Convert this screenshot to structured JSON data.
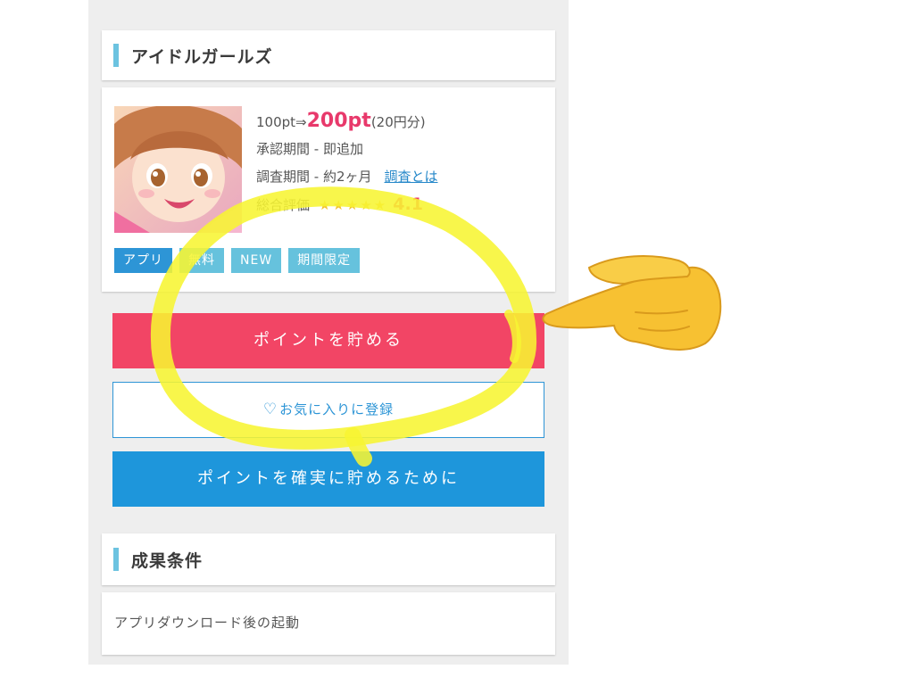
{
  "sections": {
    "offer_title": "アイドルガールズ",
    "result_title": "成果条件"
  },
  "offer": {
    "points_before": "100pt",
    "points_arrow": "⇒",
    "points_after": "200pt",
    "yen_note": "(20円分)",
    "approval": "承認期間 - 即追加",
    "survey": "調査期間 - 約2ヶ月",
    "survey_link": "調査とは",
    "rating_label": "総合評価",
    "stars": "★★★★★",
    "rating": 4.1,
    "rating_text": "4.1",
    "tags": [
      "アプリ",
      "無料",
      "NEW",
      "期間限定"
    ]
  },
  "buttons": {
    "earn": "ポイントを貯める",
    "favorite": "お気に入りに登録",
    "favorite_icon": "heart-plus-icon",
    "sure": "ポイントを確実に貯めるために"
  },
  "result": {
    "condition": "アプリダウンロード後の起動"
  },
  "annotations": {
    "highlight_color": "#f7f532",
    "pointer": "pointing-hand-emoji"
  },
  "colors": {
    "earn_button": "#f24565",
    "sure_button": "#1e96db",
    "accent_blue": "#2d95d6",
    "accent_pink": "#e8396b",
    "section_bar": "#6cc3e0"
  }
}
